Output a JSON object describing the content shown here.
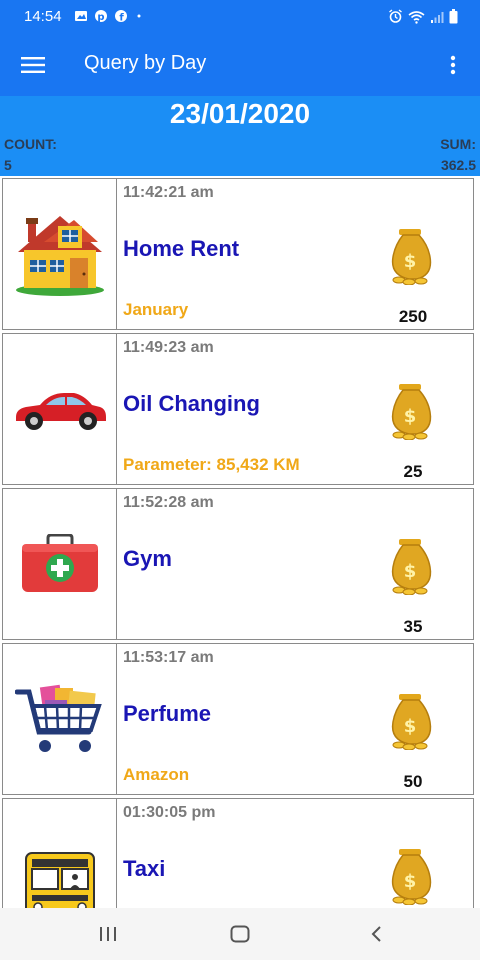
{
  "status_bar": {
    "time": "14:54"
  },
  "app_bar": {
    "title": "Query by Day"
  },
  "header": {
    "date": "23/01/2020",
    "count_label": "COUNT:",
    "count_value": "5",
    "sum_label": "SUM:",
    "sum_value": "362.5"
  },
  "entries": [
    {
      "time": "11:42:21 am",
      "title": "Home Rent",
      "note": "January",
      "amount": "250",
      "icon": "house-icon"
    },
    {
      "time": "11:49:23 am",
      "title": "Oil Changing",
      "note": "Parameter: 85,432 KM",
      "amount": "25",
      "icon": "car-icon"
    },
    {
      "time": "11:52:28 am",
      "title": "Gym",
      "note": "",
      "amount": "35",
      "icon": "first-aid-kit-icon"
    },
    {
      "time": "11:53:17 am",
      "title": "Perfume",
      "note": "Amazon",
      "amount": "50",
      "icon": "shopping-cart-icon"
    },
    {
      "time": "01:30:05 pm",
      "title": "Taxi",
      "note": "",
      "amount": "",
      "icon": "bus-icon"
    }
  ],
  "colors": {
    "app_bar": "#1976f2",
    "header": "#1b8ef5",
    "title_text": "#1a16b4",
    "note_text": "#f0a818",
    "time_text": "#7a7a7a"
  }
}
